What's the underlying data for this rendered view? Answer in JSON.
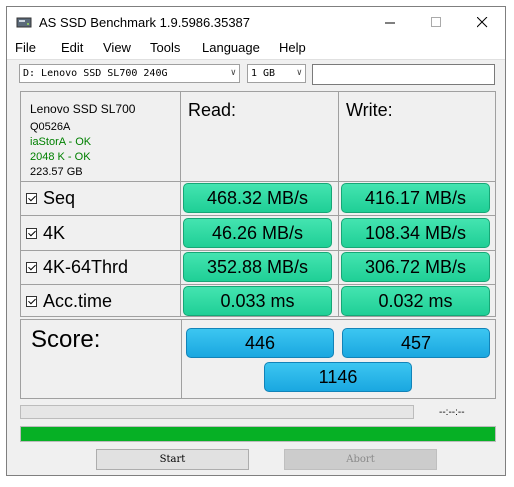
{
  "window": {
    "title": "AS SSD Benchmark 1.9.5986.35387"
  },
  "menu": [
    "File",
    "Edit",
    "View",
    "Tools",
    "Language",
    "Help"
  ],
  "toolbar": {
    "drive": "D: Lenovo SSD SL700 240G",
    "size": "1 GB",
    "input_value": ""
  },
  "drive_info": {
    "model": "Lenovo SSD SL700",
    "firmware": "Q0526A",
    "driver": "iaStorA - OK",
    "alignment": "2048 K - OK",
    "capacity": "223.57 GB"
  },
  "headers": {
    "read": "Read:",
    "write": "Write:"
  },
  "rows": [
    {
      "label": "Seq",
      "read": "468.32 MB/s",
      "write": "416.17 MB/s"
    },
    {
      "label": "4K",
      "read": "46.26 MB/s",
      "write": "108.34 MB/s"
    },
    {
      "label": "4K-64Thrd",
      "read": "352.88 MB/s",
      "write": "306.72 MB/s"
    },
    {
      "label": "Acc.time",
      "read": "0.033 ms",
      "write": "0.032 ms"
    }
  ],
  "score": {
    "label": "Score:",
    "read": "446",
    "write": "457",
    "total": "1146"
  },
  "progress": {
    "time": "--:--:--",
    "fraction": 1.0
  },
  "buttons": {
    "start": "Start",
    "abort": "Abort"
  },
  "colors": {
    "result_green": "#2ed9a2",
    "score_blue": "#28b5ea",
    "progress_green": "#06b025"
  }
}
